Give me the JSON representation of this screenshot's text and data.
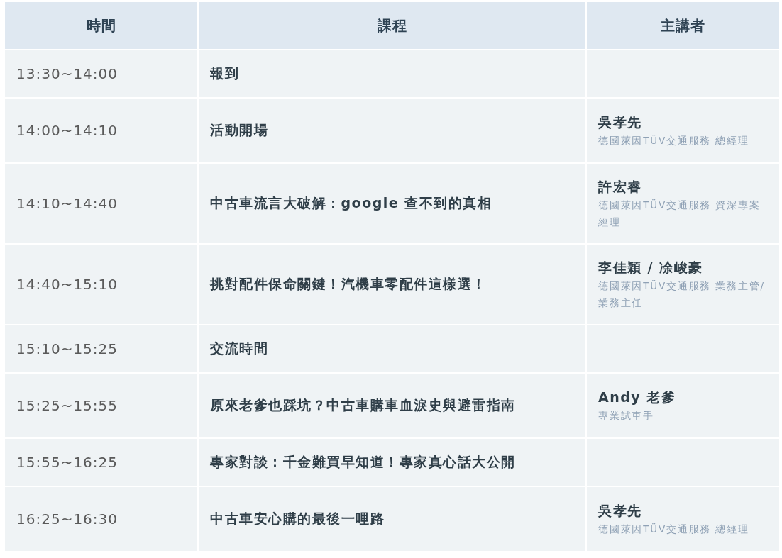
{
  "table": {
    "columns": [
      "時間",
      "課程",
      "主講者"
    ],
    "rows": [
      {
        "time": "13:30~14:00",
        "course": "報到"
      },
      {
        "time": "14:00~14:10",
        "course": "活動開場",
        "speaker": {
          "name": "吳孝先",
          "role": "德國萊因TÜV交通服務 總經理"
        }
      },
      {
        "time": "14:10~14:40",
        "course": "中古車流言大破解：google 查不到的真相",
        "speaker": {
          "name": "許宏睿",
          "role": "德國萊因TÜV交通服務 資深專案經理"
        }
      },
      {
        "time": "14:40~15:10",
        "course": "挑對配件保命關鍵！汽機車零配件這樣選！",
        "speaker": {
          "name": "李佳穎 / 凃峻豪",
          "role": "德國萊因TÜV交通服務 業務主管/ 業務主任"
        }
      },
      {
        "time": "15:10~15:25",
        "course": "交流時間"
      },
      {
        "time": "15:25~15:55",
        "course": "原來老爹也踩坑？中古車購車血淚史與避雷指南",
        "speaker": {
          "name": "Andy 老爹",
          "role": "專業試車手"
        }
      },
      {
        "time": "15:55~16:25",
        "course": "專家對談：千金難買早知道！專家真心話大公開"
      },
      {
        "time": "16:25~16:30",
        "course": "中古車安心購的最後一哩路",
        "speaker": {
          "name": "吳孝先",
          "role": "德國萊因TÜV交通服務 總經理"
        }
      }
    ]
  }
}
